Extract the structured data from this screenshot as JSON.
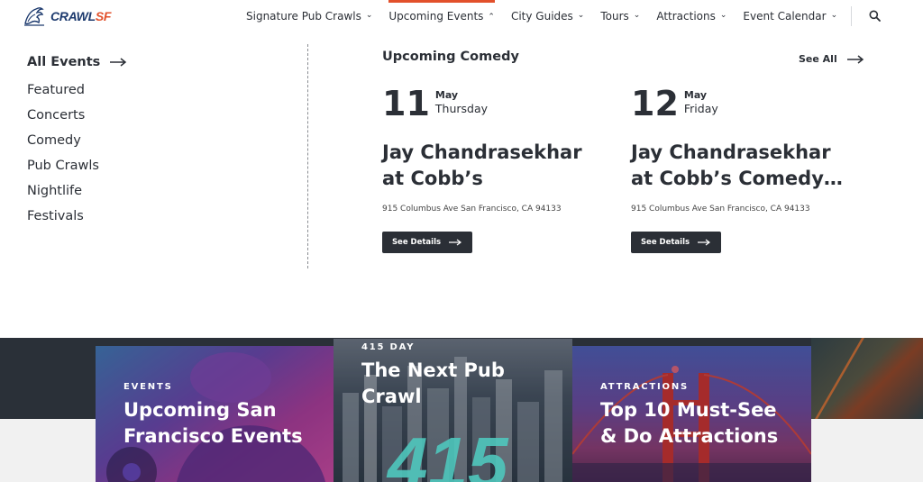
{
  "brand": {
    "name": "CRAWL",
    "accent": "SF",
    "accent_color": "#e2502b",
    "primary_color": "#1d3a6e"
  },
  "nav": {
    "items": [
      {
        "label": "Signature Pub Crawls",
        "active": false
      },
      {
        "label": "Upcoming Events",
        "active": true
      },
      {
        "label": "City Guides",
        "active": false
      },
      {
        "label": "Tours",
        "active": false
      },
      {
        "label": "Attractions",
        "active": false
      },
      {
        "label": "Event Calendar",
        "active": false
      }
    ],
    "chevron_icon": "chevron-down-icon",
    "active_chevron_icon": "chevron-up-icon",
    "search_icon": "search-icon"
  },
  "menu": {
    "all_events": "All Events",
    "categories": [
      "Featured",
      "Concerts",
      "Comedy",
      "Pub Crawls",
      "Nightlife",
      "Festivals"
    ],
    "section_title": "Upcoming Comedy",
    "see_all": "See All",
    "events": [
      {
        "day": "11",
        "month": "May",
        "weekday": "Thursday",
        "title": "Jay Chandrasekhar at Cobb’s",
        "address": "915 Columbus Ave San Francisco, CA 94133",
        "button": "See Details"
      },
      {
        "day": "12",
        "month": "May",
        "weekday": "Friday",
        "title": "Jay Chandrasekhar at Cobb’s Comedy…",
        "address": "915 Columbus Ave San Francisco, CA 94133",
        "button": "See Details"
      }
    ]
  },
  "cards": [
    {
      "kicker": "EVENTS",
      "title": "Upcoming San Francisco Events"
    },
    {
      "kicker": "415 DAY",
      "title": "The Next Pub Crawl",
      "overlay_text": "415"
    },
    {
      "kicker": "ATTRACTIONS",
      "title": "Top 10 Must-See & Do Attractions"
    }
  ]
}
